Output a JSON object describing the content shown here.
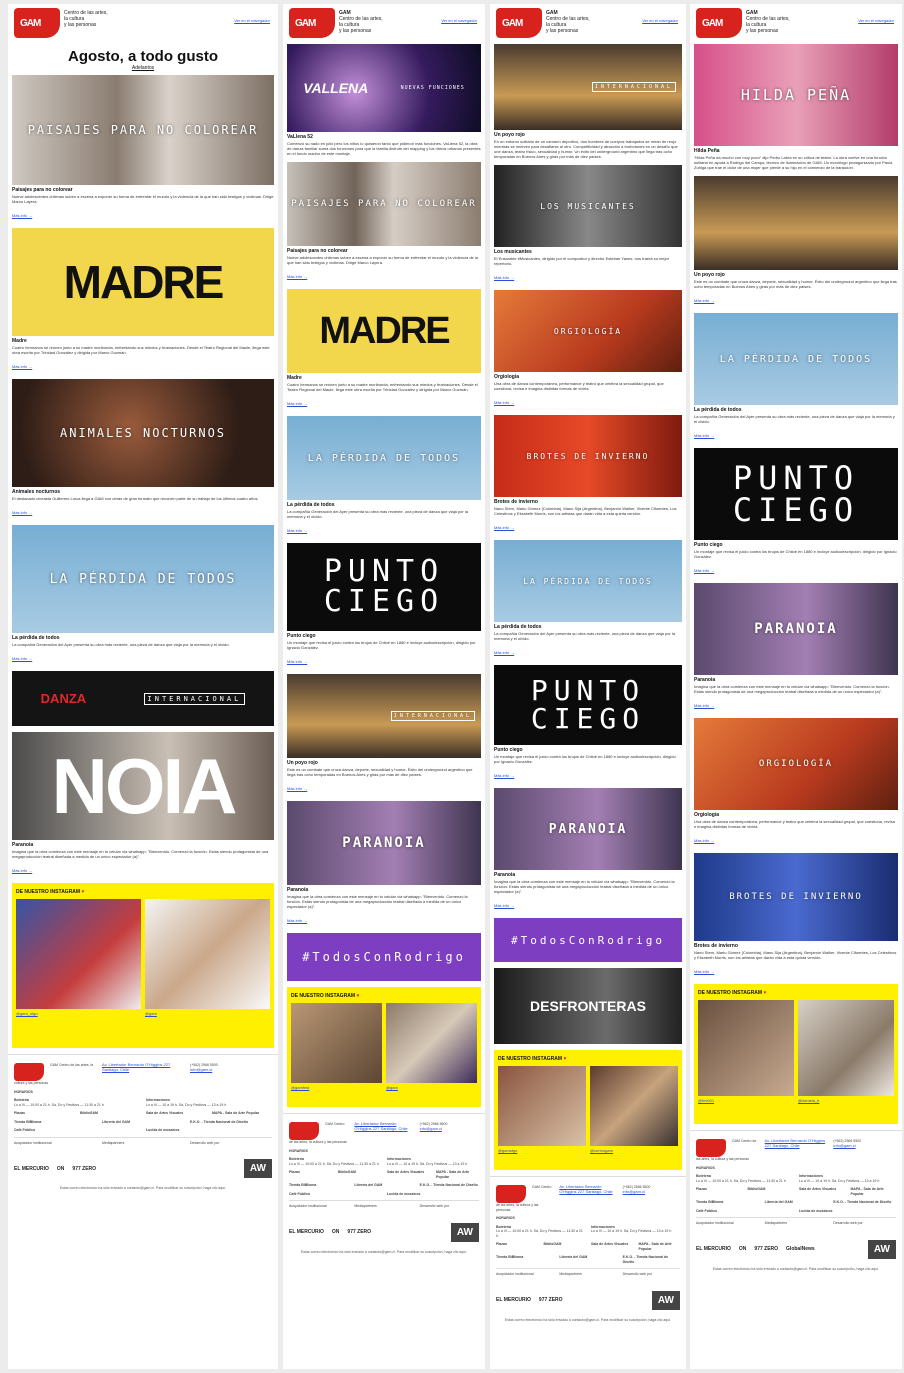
{
  "org": {
    "line1": "GAM",
    "line2": "Centro de las artes,",
    "line3": "la cultura",
    "line4": "y las personas",
    "logo_text": "GAM"
  },
  "nav_link": "Ver en el navegador",
  "col1": {
    "title": "Agosto, a todo gusto",
    "subtitle": "Adelantos",
    "cards": [
      {
        "img": "PAISAJES PARA NO COLOREAR",
        "title": "Paisajes para no colorear",
        "desc": "Nueve adolescentes chilenas suben a escena a exponer su forma de enfrentar el mundo y la violencia de la que han sido testigos y víctimas. Dirige Marco Layera.",
        "link": "Más info →"
      },
      {
        "img": "MADRE",
        "title": "Madre",
        "desc": "Cuatro hermanos se reúnen junto a su madre moribunda, enfrentando sus miedos y frustraciones. Desde el Teatro Regional del Maule, llega este obra escrita por Trinidad González y dirigida por Marco Guzmán.",
        "link": "Más info →"
      },
      {
        "img": "ANIMALES NOCTURNOS",
        "title": "Animales nocturnos",
        "desc": "El destacado cineasta Guillermo Lorca llega a GAM con obras de gran formato que recorren parte de su trabajo de los últimos cuatro años.",
        "link": "Más info →"
      },
      {
        "img": "LA PÉRDIDA DE TODOS",
        "title": "La pérdida de todos",
        "desc": "La compañía Generación del Ayer presenta su obra más reciente, una pieza de danza que viaja por la memoria y el olvido.",
        "link": "Más info →"
      },
      {
        "img": "DANZA",
        "img2": "INTERNACIONAL",
        "title": "",
        "desc": "",
        "link": ""
      },
      {
        "img": "NOIA",
        "title": "Paranoia",
        "desc": "Imagina que la obra comienza con este mensaje en tu celular vía whatsapp: \"Bienvenido. Comenzó la función. Estás siendo protagonista de una megaproducción teatral diseñada a medida de un único espectador (a)\".",
        "link": "Más info →"
      }
    ],
    "instagram": {
      "heading": "DE NUESTRO INSTAGRAM",
      "cap1": "@gam_stgo",
      "cap2": "@gam"
    }
  },
  "col2": {
    "cards": [
      {
        "img": "VALLENA",
        "img2": "NUEVAS FUNCIONES",
        "title": "VaLlena 52",
        "desc": "Comenzó su nado en julio pero los niños lo quisieron tanto que pidieron más funciones. VaLlena 52, la obra de danza familiar suma dos funciones para que la familia disfrute del mapping y los ritmos urbanos presentes en el fondo marino de este montaje.",
        "link": ""
      },
      {
        "img": "PAISAJES PARA NO COLOREAR",
        "title": "Paisajes para no colorear",
        "desc": "Nueve adolescentes chilenas suben a escena a exponer su forma de enfrentar el mundo y la violencia de la que han sido testigos y víctimas. Dirige Marco Layera.",
        "link": "Más info →"
      },
      {
        "img": "MADRE",
        "title": "Madre",
        "desc": "Cuatro hermanos se reúnen junto a su madre moribunda, enfrentando sus miedos y frustraciones. Desde el Teatro Regional del Maule, llega este obra escrita por Trinidad González y dirigida por Marco Guzmán.",
        "link": "Más info →"
      },
      {
        "img": "LA PÉRDIDA DE TODOS",
        "title": "La pérdida de todos",
        "desc": "La compañía Generación del Ayer presenta su obra más reciente, una pieza de danza que viaja por la memoria y el olvido.",
        "link": "Más info →"
      },
      {
        "img": "PUNTO CIEGO",
        "title": "Punto ciego",
        "desc": "Un montaje que revisa el juicio contra los brujos de Chiloé en 1880 e incluye audiodescripción, dirigido por Ignacio González.",
        "link": "Más info →"
      },
      {
        "img": "INTERNACIONAL",
        "title": "Un poyo rojo",
        "desc": "Este es un combate que cruza danza, deporte, sexualidad y humor. Éxito del underground argentino que llega tras ocho temporadas en Buenos Aires y giras por más de diez países.",
        "link": "Más info →"
      },
      {
        "img": "PARANOIA",
        "title": "Paranoia",
        "desc": "Imagina que la obra comienza con este mensaje en tu celular vía whatsapp: \"Bienvenido. Comenzó la función. Estás siendo protagonista de una megaproducción teatral diseñada a medida de un único espectador (a)\".",
        "link": "Más info →"
      },
      {
        "img": "#TodosConRodrigo",
        "title": "",
        "desc": "",
        "link": ""
      }
    ],
    "instagram": {
      "heading": "DE NUESTRO INSTAGRAM",
      "cap1": "@gamfest",
      "cap2": "@gam"
    }
  },
  "col3": {
    "cards": [
      {
        "img": "INTERNACIONAL",
        "title": "Un poyo rojo",
        "desc": "En un entorno solitario de un camarín deportivo, dos hombres de cuerpos trabajados se miran de reojo mientras se mueven para desafiarse al otro. Competitividad y atracción a borbotones en un desafío que une danza, teatro físico, sexualidad y humor. Un éxito del underground argentino que llega tras ocho temporadas en Buenos Aires y giras por más de diez países.",
        "link": ""
      },
      {
        "img": "LOS MUSICANTES",
        "title": "Los musicantes",
        "desc": "El Ensamble #Musicantes, dirigido por el compositor y director Esteban Yanes, nos traerá su mejor repertorio.",
        "link": "Más info →"
      },
      {
        "img": "ORGIOLOGÍA",
        "title": "Orgiología",
        "desc": "Una obra de danza contemporánea, performance y teatro que celebra la sexualidad grupal, que cuestiona, revisa e imagina distintas formas de vivirla.",
        "link": "Más info →"
      },
      {
        "img": "BROTES DE INVIERNO",
        "title": "Brotes de invierno",
        "desc": "Nano Stern, Mariu Gómez (Colombia), Manu Sija (Argentina), Benjamín Walker, Vicente Cifuentes, Los Celestinos y Elizabeth Morris, son los artistas que darán vida a esta quinta versión.",
        "link": "Más info →"
      },
      {
        "img": "LA PÉRDIDA DE TODOS",
        "title": "La pérdida de todos",
        "desc": "La compañía Generación del Ayer presenta su obra más reciente, una pieza de danza que viaja por la memoria y el olvido.",
        "link": "Más info →"
      },
      {
        "img": "PUNTO CIEGO",
        "title": "Punto ciego",
        "desc": "Un montaje que revisa el juicio contra los brujos de Chiloé en 1880 e incluye audiodescripción, dirigido por Ignacio González.",
        "link": "Más info →"
      },
      {
        "img": "PARANOIA",
        "title": "Paranoia",
        "desc": "Imagina que la obra comienza con este mensaje en tu celular vía whatsapp: \"Bienvenido. Comenzó la función. Estás siendo protagonista de una megaproducción teatral diseñada a medida de un único espectador (a)\".",
        "link": "Más info →"
      },
      {
        "img": "#TodosConRodrigo",
        "title": "",
        "desc": "",
        "link": ""
      },
      {
        "img": "DESFRONTERAS",
        "title": "",
        "desc": "",
        "link": ""
      }
    ],
    "instagram": {
      "heading": "DE NUESTRO INSTAGRAM",
      "cap1": "@gamstgo",
      "cap2": "@centrogam"
    }
  },
  "col4": {
    "cards": [
      {
        "img": "HILDA PEÑA",
        "title": "Hilda Peña",
        "desc": "\"Hilda Peña da mucho con muy poco\" dijo Pedro Labra en su crítica de teatro. La obra vuelve en una función solitaria en ayuda a Rodrigo del Campo, técnico de iluminación de GAM. Un monólogo protagonizado por Paula Zúñiga que trae el dolor de una mujer que pierde a su hijo en el comienzo de la transición.",
        "link": ""
      },
      {
        "img": "",
        "title": "Un poyo rojo",
        "desc": "Este es un combate que cruza danza, deporte, sexualidad y humor. Éxito del underground argentino que llega tras ocho temporadas en Buenos Aires y giras por más de diez países.",
        "link": "Más info →"
      },
      {
        "img": "LA PÉRDIDA DE TODOS",
        "title": "La pérdida de todos",
        "desc": "La compañía Generación del Ayer presenta su obra más reciente, una pieza de danza que viaja por la memoria y el olvido.",
        "link": "Más info →"
      },
      {
        "img": "PUNTO CIEGO",
        "title": "Punto ciego",
        "desc": "Un montaje que revisa el juicio contra los brujos de Chiloé en 1880 e incluye audiodescripción, dirigido por Ignacio González.",
        "link": "Más info →"
      },
      {
        "img": "PARANOIA",
        "title": "Paranoia",
        "desc": "Imagina que la obra comienza con este mensaje en tu celular vía whatsapp: \"Bienvenido. Comenzó la función. Estás siendo protagonista de una megaproducción teatral diseñada a medida de un único espectador (a)\".",
        "link": "Más info →"
      },
      {
        "img": "ORGIOLOGÍA",
        "title": "Orgiología",
        "desc": "Una obra de danza contemporánea, performance y teatro que celebra la sexualidad grupal, que cuestiona, revisa e imagina distintas formas de vivirla.",
        "link": "Más info →"
      },
      {
        "img": "BROTES DE INVIERNO",
        "title": "Brotes de invierno",
        "desc": "Nano Stern, Mariu Gómez (Colombia), Manu Sija (Argentina), Benjamín Walker, Vicente Cifuentes, Los Celestinos y Elizabeth Morris, son los artistas que darán vida a esta quinta versión.",
        "link": "Más info →"
      }
    ],
    "instagram": {
      "heading": "DE NUESTRO INSTAGRAM",
      "cap1": "@fmi001",
      "cap2": "@daniela_b"
    }
  },
  "footer": {
    "org": "GAM Centro de las artes, la cultura y las personas",
    "address": "Av. Libertador Bernardo O'Higgins 227 Santiago, Chile",
    "phone": "(+562) 2566 5500",
    "email": "info@gam.cl",
    "horarios_h": "HORARIOS",
    "boleteria": "Boletería",
    "boleteria_t": "Lu a Vi — 10:00 a 21 h. Sá, Do y Festivos — 11:30 a 21 h",
    "informaciones": "Informaciones",
    "informaciones_t": "Lu a Vi — 10 a 19 h. Sá, Do y Festivos — 13 a 19 h",
    "plazas": "Plazas",
    "bibliogam": "BiblioGAM",
    "salas": "Sala de Artes Visuales",
    "mapa": "MAPA - Sala de Arte Popular",
    "tienda": "Tienda BiBlioma",
    "libreria": "Librería del GAM",
    "eko": "E.K.O. - Tienda Nacional de Diseño",
    "cafe": "Café Público",
    "lucida": "Lucida de mosaicos",
    "auspiciador": "Auspiciador institucional",
    "mediapartners": "Mediapartners",
    "desarrollo": "Desarrollo web por",
    "mercurio": "EL MERCURIO",
    "on": "ON",
    "zero": "977 ZERO",
    "globalnews": "GlobalNews",
    "aw": "AW",
    "legal": "Estas correo electrónico ha sido enviado a contacto@gam.cl. Para modificar su suscripción, haga clic aquí."
  },
  "colors": {
    "brand_red": "#d8221e",
    "insta_yellow": "#fff000",
    "purple": "#7d3ec1",
    "link_blue": "#2a4fd6"
  }
}
